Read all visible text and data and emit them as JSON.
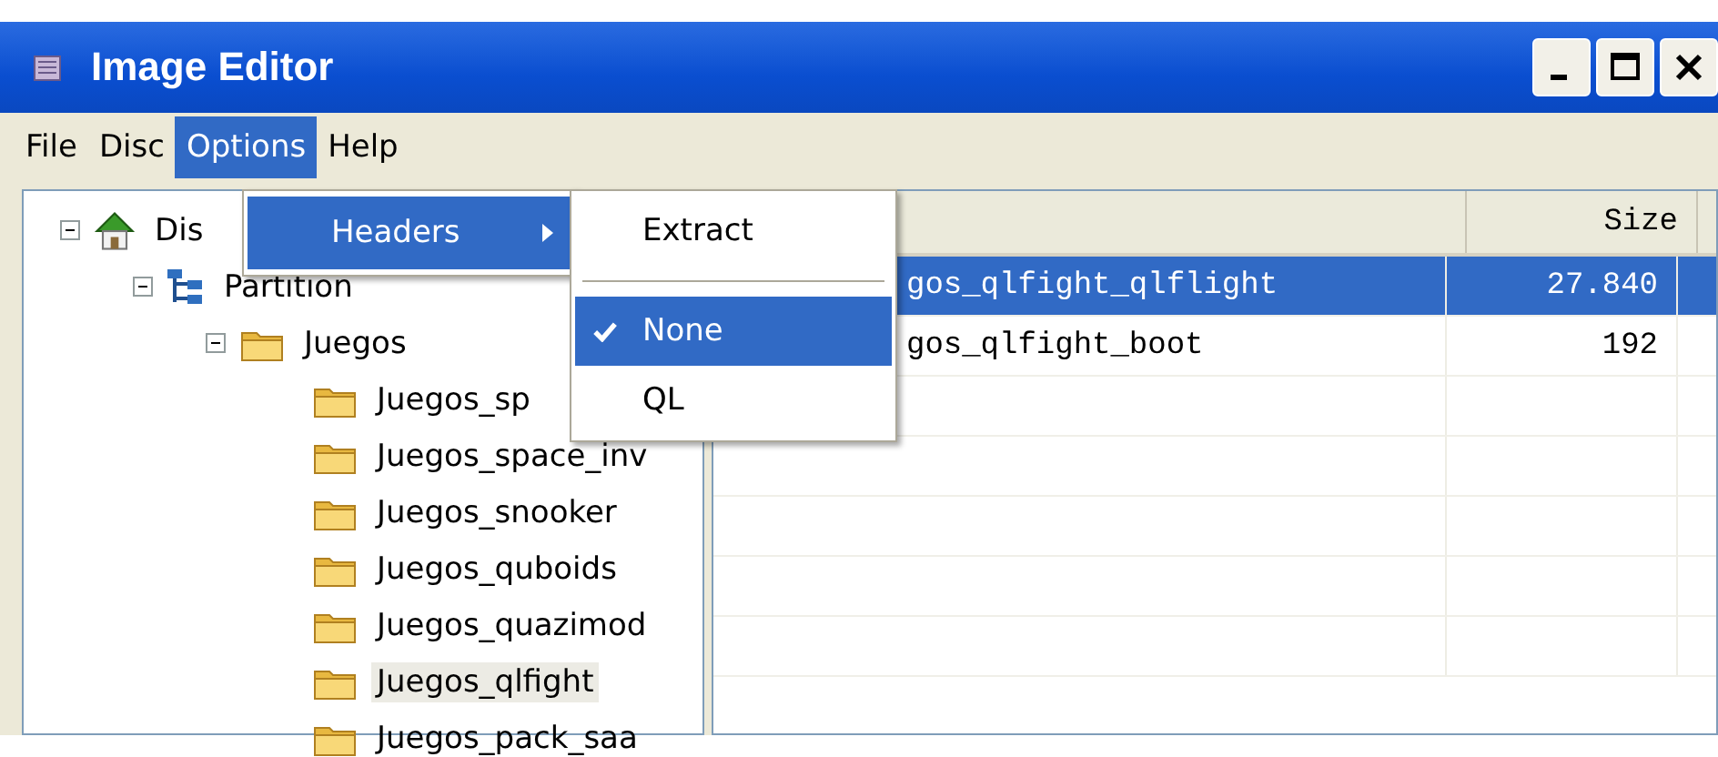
{
  "window": {
    "title": "Image Editor"
  },
  "menu_bar": [
    {
      "label": "File",
      "selected": false
    },
    {
      "label": "Disc",
      "selected": false
    },
    {
      "label": "Options",
      "selected": true
    },
    {
      "label": "Help",
      "selected": false
    }
  ],
  "options_menu": {
    "items": [
      {
        "label": "Headers",
        "selected": true,
        "has_submenu": true
      }
    ]
  },
  "headers_submenu": {
    "items": [
      {
        "kind": "item",
        "label": "Extract",
        "checked": false,
        "selected": false
      },
      {
        "kind": "separator"
      },
      {
        "kind": "item",
        "label": "None",
        "checked": true,
        "selected": true
      },
      {
        "kind": "item",
        "label": "QL",
        "checked": false,
        "selected": false
      }
    ]
  },
  "tree": [
    {
      "kind": "disc",
      "label": "Dis",
      "expanded": true,
      "selected": false,
      "children": [
        {
          "kind": "partition",
          "label": "Partition",
          "expanded": true,
          "selected": false,
          "children": [
            {
              "kind": "folder",
              "label": "Juegos",
              "expanded": true,
              "selected": false,
              "children": [
                {
                  "kind": "folder",
                  "label": "Juegos_sp",
                  "selected": false
                },
                {
                  "kind": "folder",
                  "label": "Juegos_space_inv",
                  "selected": false
                },
                {
                  "kind": "folder",
                  "label": "Juegos_snooker",
                  "selected": false
                },
                {
                  "kind": "folder",
                  "label": "Juegos_quboids",
                  "selected": false
                },
                {
                  "kind": "folder",
                  "label": "Juegos_quazimod",
                  "selected": false
                },
                {
                  "kind": "folder",
                  "label": "Juegos_qlfight",
                  "selected": true
                },
                {
                  "kind": "folder",
                  "label": "Juegos_pack_saa",
                  "selected": false
                }
              ]
            }
          ]
        }
      ]
    }
  ],
  "file_list": {
    "size_header": "Size",
    "rows": [
      {
        "name": "gos_qlfight_qlflight",
        "size": "27.840",
        "selected": true
      },
      {
        "name": "gos_qlfight_boot",
        "size": "192",
        "selected": false
      }
    ]
  }
}
